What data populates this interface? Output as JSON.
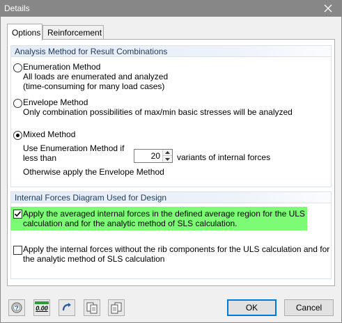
{
  "window": {
    "title": "Details"
  },
  "tabs": [
    {
      "label": "Options",
      "active": true
    },
    {
      "label": "Reinforcement",
      "active": false
    }
  ],
  "analysis_method": {
    "header": "Analysis Method for Result Combinations",
    "enumeration": {
      "label": "Enumeration Method",
      "desc1": "All loads are enumerated and analyzed",
      "desc2": "(time-consuming for many load cases)",
      "selected": false
    },
    "envelope": {
      "label": "Envelope Method",
      "desc": "Only combination possibilities of max/min basic stresses will be analyzed",
      "selected": false
    },
    "mixed": {
      "label": "Mixed Method",
      "selected": true,
      "line1": "Use Enumeration Method if",
      "line2": "less than",
      "variants_value": "20",
      "variants_suffix": "variants of internal forces",
      "otherwise": "Otherwise apply the Envelope Method"
    }
  },
  "internal_forces": {
    "header": "Internal Forces Diagram Used for Design",
    "averaged": {
      "checked": true,
      "line1": "Apply the averaged internal forces in the defined average region for the ULS",
      "line2": "calculation and for the analytic method of SLS calculation."
    },
    "without_ribs": {
      "checked": false,
      "line1": "Apply the internal forces without the rib components for the ULS calculation and for",
      "line2": "the analytic method of SLS calculation"
    }
  },
  "toolbar": {
    "icons": [
      "help-icon",
      "units-icon",
      "reset-icon",
      "import-icon",
      "export-icon"
    ],
    "units_text": "0.00"
  },
  "buttons": {
    "ok": "OK",
    "cancel": "Cancel"
  },
  "colors": {
    "highlight": "#7cfc74",
    "group_header_text": "#1e395b",
    "title_bar": "#878787"
  }
}
